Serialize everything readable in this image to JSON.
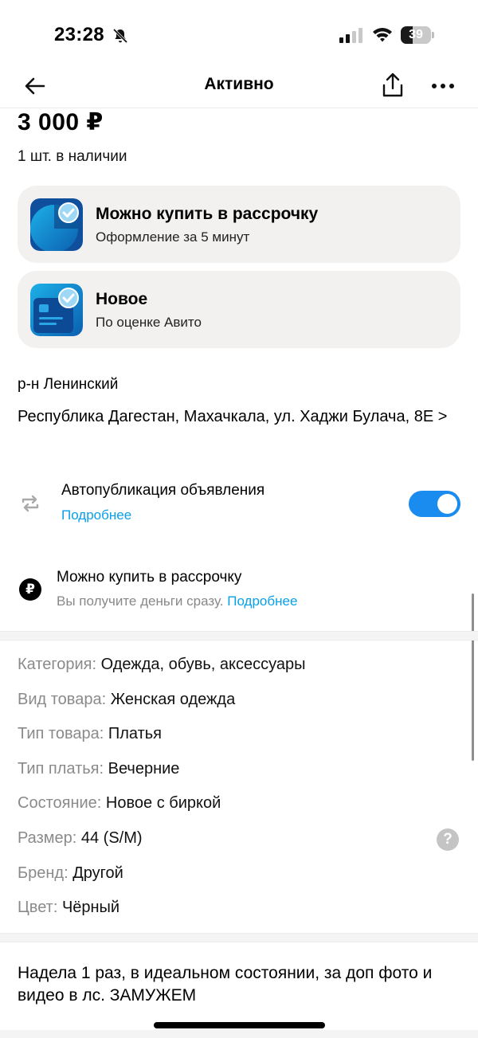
{
  "status_bar": {
    "time": "23:28",
    "battery": "39"
  },
  "nav": {
    "title": "Активно"
  },
  "listing": {
    "price": "3 000 ₽",
    "stock": "1 шт. в наличии"
  },
  "promo_cards": [
    {
      "title": "Можно купить в рассрочку",
      "subtitle": "Оформление за 5 минут",
      "icon": "installment-badge-icon"
    },
    {
      "title": "Новое",
      "subtitle": "По оценке Авито",
      "icon": "new-badge-icon"
    }
  ],
  "location": {
    "district": "р-н Ленинский",
    "address": "Республика Дагестан, Махачкала, ул. Хаджи Булача, 8Е",
    "chevron": ">"
  },
  "autopublication": {
    "title": "Автопубликация объявления",
    "link": "Подробнее",
    "enabled": true,
    "icon": "repeat-icon"
  },
  "installment": {
    "icon_glyph": "₽",
    "title": "Можно купить в рассрочку",
    "subtitle": "Вы получите деньги сразу.",
    "link": "Подробнее"
  },
  "params": [
    {
      "key": "Категория:",
      "value": "Одежда, обувь, аксессуары"
    },
    {
      "key": "Вид товара:",
      "value": "Женская одежда"
    },
    {
      "key": "Тип товара:",
      "value": "Платья"
    },
    {
      "key": "Тип платья:",
      "value": "Вечерние"
    },
    {
      "key": "Состояние:",
      "value": "Новое с биркой"
    },
    {
      "key": "Размер:",
      "value": "44 (S/M)"
    },
    {
      "key": "Бренд:",
      "value": "Другой"
    },
    {
      "key": "Цвет:",
      "value": "Чёрный"
    }
  ],
  "help_glyph": "?",
  "description": "Надела 1 раз, в идеальном состоянии, за доп фото и видео в лс. ЗАМУЖЕМ",
  "colors": {
    "accent_link": "#0aa0e8",
    "toggle_on": "#1a8cf0",
    "card_bg": "#f2f1f0"
  }
}
